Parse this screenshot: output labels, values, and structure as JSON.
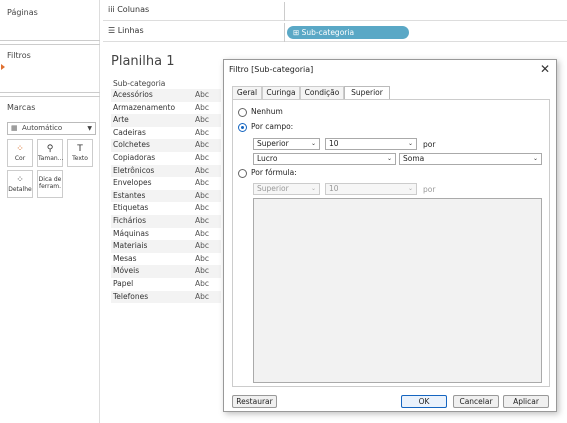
{
  "left": {
    "pages_title": "Páginas",
    "filters_title": "Filtros",
    "marks_title": "Marcas",
    "marks_type": "Automático",
    "mark_buttons": [
      "Cor",
      "Taman...",
      "Texto",
      "Detalhe",
      "Dica de ferram."
    ]
  },
  "shelves": {
    "columns_label": "Colunas",
    "rows_label": "Linhas",
    "rows_pill": "Sub-categoria"
  },
  "sheet": {
    "title": "Planilha 1",
    "column_header": "Sub-categoria",
    "rows": [
      {
        "name": "Acessórios",
        "value": "Abc"
      },
      {
        "name": "Armazenamento",
        "value": "Abc"
      },
      {
        "name": "Arte",
        "value": "Abc"
      },
      {
        "name": "Cadeiras",
        "value": "Abc"
      },
      {
        "name": "Colchetes",
        "value": "Abc"
      },
      {
        "name": "Copiadoras",
        "value": "Abc"
      },
      {
        "name": "Eletrônicos",
        "value": "Abc"
      },
      {
        "name": "Envelopes",
        "value": "Abc"
      },
      {
        "name": "Estantes",
        "value": "Abc"
      },
      {
        "name": "Etiquetas",
        "value": "Abc"
      },
      {
        "name": "Fichários",
        "value": "Abc"
      },
      {
        "name": "Máquinas",
        "value": "Abc"
      },
      {
        "name": "Materiais",
        "value": "Abc"
      },
      {
        "name": "Mesas",
        "value": "Abc"
      },
      {
        "name": "Móveis",
        "value": "Abc"
      },
      {
        "name": "Papel",
        "value": "Abc"
      },
      {
        "name": "Telefones",
        "value": "Abc"
      }
    ]
  },
  "dialog": {
    "title": "Filtro [Sub-categoria]",
    "tabs": [
      "Geral",
      "Curinga",
      "Condição",
      "Superior"
    ],
    "active_tab": "Superior",
    "options": {
      "none": "Nenhum",
      "by_field": "Por campo:",
      "by_formula": "Por fórmula:"
    },
    "selected_option": "by_field",
    "by_field": {
      "direction": "Superior",
      "count": "10",
      "by_label": "por",
      "field": "Lucro",
      "aggregation": "Soma"
    },
    "by_formula": {
      "direction": "Superior",
      "count": "10",
      "by_label": "por"
    },
    "buttons": {
      "reset": "Restaurar",
      "ok": "OK",
      "cancel": "Cancelar",
      "apply": "Aplicar"
    }
  },
  "colors": {
    "pill": "#5aa8c6",
    "accent": "#1565c0"
  }
}
